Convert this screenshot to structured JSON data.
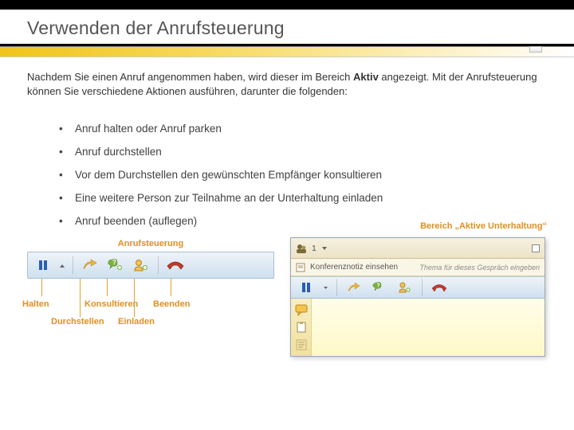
{
  "title": "Verwenden der Anrufsteuerung",
  "intro_html_parts": {
    "a": "Nachdem Sie einen Anruf angenommen haben, wird dieser im Bereich ",
    "b": "Aktiv",
    "c": " angezeigt. Mit der Anrufsteuerung können Sie verschiedene Aktionen ausführen, darunter die folgenden:"
  },
  "bullets": [
    "Anruf halten oder Anruf parken",
    "Anruf durchstellen",
    "Vor dem Durchstellen den gewünschten Empfänger konsultieren",
    "Eine weitere Person zur Teilnahme an der Unterhaltung einladen",
    "Anruf beenden (auflegen)"
  ],
  "left_panel": {
    "caption": "Anrufsteuerung",
    "labels": {
      "hold": "Halten",
      "transfer": "Durchstellen",
      "consult": "Konsultieren",
      "invite": "Einladen",
      "end": "Beenden"
    }
  },
  "right_panel": {
    "caption": "Bereich „Aktive Unterhaltung“",
    "participant_count": "1",
    "note_label": "Konferenznotiz einsehen",
    "theme_prompt": "Thema für dieses Gespräch eingeben"
  },
  "icons": {
    "pause": "pause-icon",
    "transfer": "transfer-arrow-icon",
    "consult": "consult-icon",
    "invite": "invite-person-icon",
    "end": "hangup-icon",
    "people": "people-icon",
    "note": "note-icon",
    "clip": "clip-icon",
    "msg": "message-icon"
  }
}
